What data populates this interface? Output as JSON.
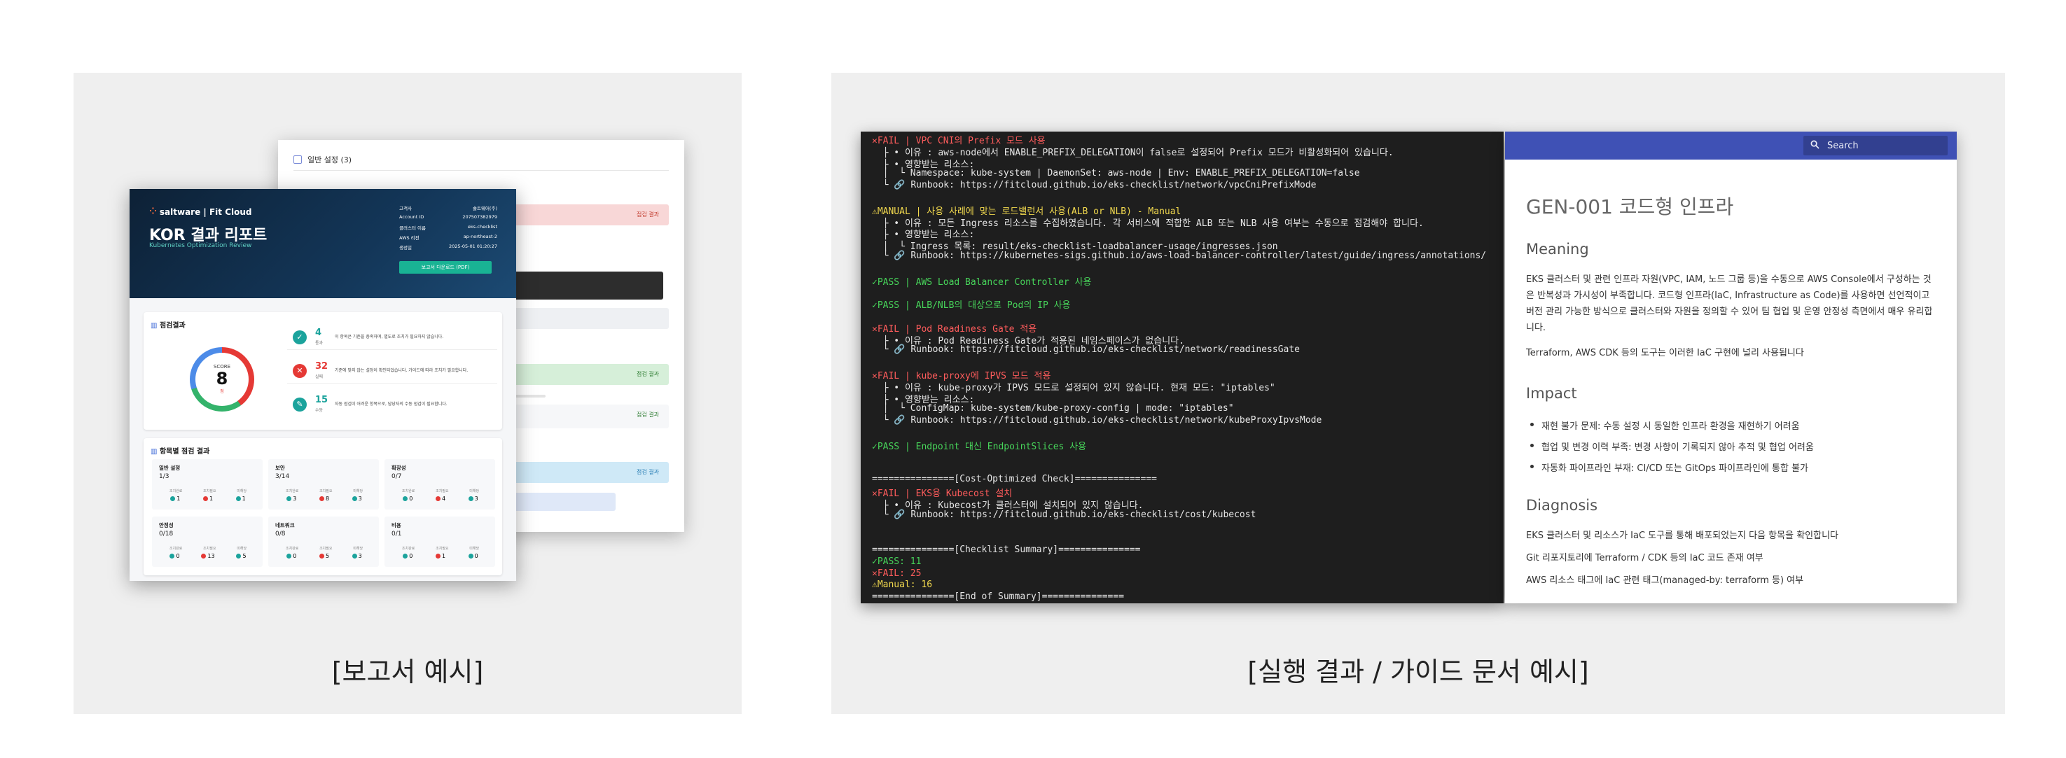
{
  "captions": {
    "left": "[보고서 예시]",
    "right": "[실행 결과 / 가이드 문서 예시]"
  },
  "report": {
    "back_header": "일반 설정 (3)",
    "back_tags": [
      "점검 결과",
      "점검 결과",
      "점검 결과",
      "점검 결과"
    ],
    "brand": "saltware | Fit Cloud",
    "title": "KOR 결과 리포트",
    "subtitle": "Kubernetes Optimization Review",
    "meta": [
      {
        "k": "고객사",
        "v": "솔트웨어(주)"
      },
      {
        "k": "Account ID",
        "v": "207507382979"
      },
      {
        "k": "클러스터 이름",
        "v": "eks-checklist"
      },
      {
        "k": "AWS 리전",
        "v": "ap-northeast-2"
      },
      {
        "k": "생성일",
        "v": "2025-05-01 01:20:27"
      }
    ],
    "download_button": "보고서 다운로드 (PDF)",
    "summary_title": "점검결과",
    "score_label": "SCORE",
    "score": "8",
    "score_unit": "점",
    "stats": [
      {
        "n": "4",
        "u": "통과",
        "d": "이 항목은 기준을 충족하며, 별도로 조치가 필요하지 않습니다.",
        "color": "#1ba39c"
      },
      {
        "n": "32",
        "u": "실패",
        "d": "기준에 맞지 않는 설정이 확인되었습니다. 가이드에 따라 조치가 필요합니다.",
        "color": "#e53935"
      },
      {
        "n": "15",
        "u": "수동",
        "d": "자동 점검이 어려운 항목으로, 담당자의 수동 점검이 필요합니다.",
        "color": "#1ba39c"
      }
    ],
    "category_title": "항목별 점검 결과",
    "count_labels": [
      "조치완료",
      "조치필요",
      "미해당"
    ],
    "categories": [
      {
        "name": "일반 설정",
        "count": "1/3",
        "vals": [
          "1",
          "1",
          "1"
        ]
      },
      {
        "name": "보안",
        "count": "3/14",
        "vals": [
          "3",
          "8",
          "3"
        ]
      },
      {
        "name": "확장성",
        "count": "0/7",
        "vals": [
          "0",
          "4",
          "3"
        ]
      },
      {
        "name": "안정성",
        "count": "0/18",
        "vals": [
          "0",
          "13",
          "5"
        ]
      },
      {
        "name": "네트워크",
        "count": "0/8",
        "vals": [
          "0",
          "5",
          "3"
        ]
      },
      {
        "name": "비용",
        "count": "0/1",
        "vals": [
          "0",
          "1",
          "0"
        ]
      }
    ]
  },
  "terminal": {
    "lines": [
      {
        "t": "✕FAIL | VPC CNI의 Prefix 모드 사용",
        "c": "#ff5c5c"
      },
      {
        "t": "  ├ • 이유 : aws-node에서 ENABLE_PREFIX_DELEGATION이 false로 설정되어 Prefix 모드가 비활성화되어 있습니다.",
        "c": "#e6e6e6"
      },
      {
        "t": "  ├ • 영향받는 리소스:",
        "c": "#e6e6e6"
      },
      {
        "t": "  │  └ Namespace: kube-system | DaemonSet: aws-node | Env: ENABLE_PREFIX_DELEGATION=false",
        "c": "#e6e6e6"
      },
      {
        "t": "  └ 🔗 Runbook: https://fitcloud.github.io/eks-checklist/network/vpcCniPrefixMode",
        "c": "#e6e6e6"
      },
      {
        "t": "",
        "c": "#e6e6e6"
      },
      {
        "t": "⚠MANUAL | 사용 사례에 맞는 로드밸런서 사용(ALB or NLB) - Manual",
        "c": "#f2d94e"
      },
      {
        "t": "  ├ • 이유 : 모든 Ingress 리소스를 수집하였습니다. 각 서비스에 적합한 ALB 또는 NLB 사용 여부는 수동으로 점검해야 합니다.",
        "c": "#e6e6e6"
      },
      {
        "t": "  ├ • 영향받는 리소스:",
        "c": "#e6e6e6"
      },
      {
        "t": "  │  └ Ingress 목록: result/eks-checklist-loadbalancer-usage/ingresses.json",
        "c": "#e6e6e6"
      },
      {
        "t": "  └ 🔗 Runbook: https://kubernetes-sigs.github.io/aws-load-balancer-controller/latest/guide/ingress/annotations/",
        "c": "#e6e6e6"
      },
      {
        "t": "",
        "c": "#e6e6e6"
      },
      {
        "t": "✓PASS | AWS Load Balancer Controller 사용",
        "c": "#47d45a"
      },
      {
        "t": "",
        "c": "#e6e6e6"
      },
      {
        "t": "✓PASS | ALB/NLB의 대상으로 Pod의 IP 사용",
        "c": "#47d45a"
      },
      {
        "t": "",
        "c": "#e6e6e6"
      },
      {
        "t": "✕FAIL | Pod Readiness Gate 적용",
        "c": "#ff5c5c"
      },
      {
        "t": "  ├ • 이유 : Pod Readiness Gate가 적용된 네임스페이스가 없습니다.",
        "c": "#e6e6e6"
      },
      {
        "t": "  └ 🔗 Runbook: https://fitcloud.github.io/eks-checklist/network/readinessGate",
        "c": "#e6e6e6"
      },
      {
        "t": "",
        "c": "#e6e6e6"
      },
      {
        "t": "✕FAIL | kube-proxy에 IPVS 모드 적용",
        "c": "#ff5c5c"
      },
      {
        "t": "  ├ • 이유 : kube-proxy가 IPVS 모드로 설정되어 있지 않습니다. 현재 모드: \"iptables\"",
        "c": "#e6e6e6"
      },
      {
        "t": "  ├ • 영향받는 리소스:",
        "c": "#e6e6e6"
      },
      {
        "t": "  │  └ ConfigMap: kube-system/kube-proxy-config | mode: \"iptables\"",
        "c": "#e6e6e6"
      },
      {
        "t": "  └ 🔗 Runbook: https://fitcloud.github.io/eks-checklist/network/kubeProxyIpvsMode",
        "c": "#e6e6e6"
      },
      {
        "t": "",
        "c": "#e6e6e6"
      },
      {
        "t": "✓PASS | Endpoint 대신 EndpointSlices 사용",
        "c": "#47d45a"
      },
      {
        "t": "",
        "c": "#e6e6e6"
      },
      {
        "t": "",
        "c": "#e6e6e6"
      },
      {
        "t": "===============[Cost-Optimized Check]===============",
        "c": "#e6e6e6"
      },
      {
        "t": "✕FAIL | EKS용 Kubecost 설치",
        "c": "#ff5c5c"
      },
      {
        "t": "  ├ • 이유 : Kubecost가 클러스터에 설치되어 있지 않습니다.",
        "c": "#e6e6e6"
      },
      {
        "t": "  └ 🔗 Runbook: https://fitcloud.github.io/eks-checklist/cost/kubecost",
        "c": "#e6e6e6"
      },
      {
        "t": "",
        "c": "#e6e6e6"
      },
      {
        "t": "",
        "c": "#e6e6e6"
      },
      {
        "t": "===============[Checklist Summary]===============",
        "c": "#e6e6e6"
      },
      {
        "t": "✓PASS: 11",
        "c": "#47d45a"
      },
      {
        "t": "✕FAIL: 25",
        "c": "#ff5c5c"
      },
      {
        "t": "⚠Manual: 16",
        "c": "#f2d94e"
      },
      {
        "t": "===============[End of Summary]===============",
        "c": "#e6e6e6"
      }
    ]
  },
  "doc": {
    "search_placeholder": "Search",
    "title": "GEN-001 코드형 인프라",
    "meaning_h": "Meaning",
    "meaning_p1": "EKS 클러스터 및 관련 인프라 자원(VPC, IAM, 노드 그룹 등)을 수동으로 AWS Console에서 구성하는 것은 반복성과 가시성이 부족합니다. 코드형 인프라(IaC, Infrastructure as Code)를 사용하면 선언적이고 버전 관리 가능한 방식으로 클러스터와 자원을 정의할 수 있어 팀 협업 및 운영 안정성 측면에서 매우 유리합니다.",
    "meaning_p2": "Terraform, AWS CDK 등의 도구는 이러한 IaC 구현에 널리 사용됩니다",
    "impact_h": "Impact",
    "impact_items": [
      "재현 불가 문제: 수동 설정 시 동일한 인프라 환경을 재현하기 어려움",
      "협업 및 변경 이력 부족: 변경 사항이 기록되지 않아 추적 및 협업 어려움",
      "자동화 파이프라인 부재: CI/CD 또는 GitOps 파이프라인에 통합 불가"
    ],
    "diagnosis_h": "Diagnosis",
    "diagnosis_p": [
      "EKS 클러스터 및 리소스가 IaC 도구를 통해 배포되었는지 다음 항목을 확인합니다",
      "Git 리포지토리에 Terraform / CDK 등의 IaC 코드 존재 여부",
      "AWS 리소스 태그에 IaC 관련 태그(managed-by: terraform 등) 여부"
    ]
  }
}
